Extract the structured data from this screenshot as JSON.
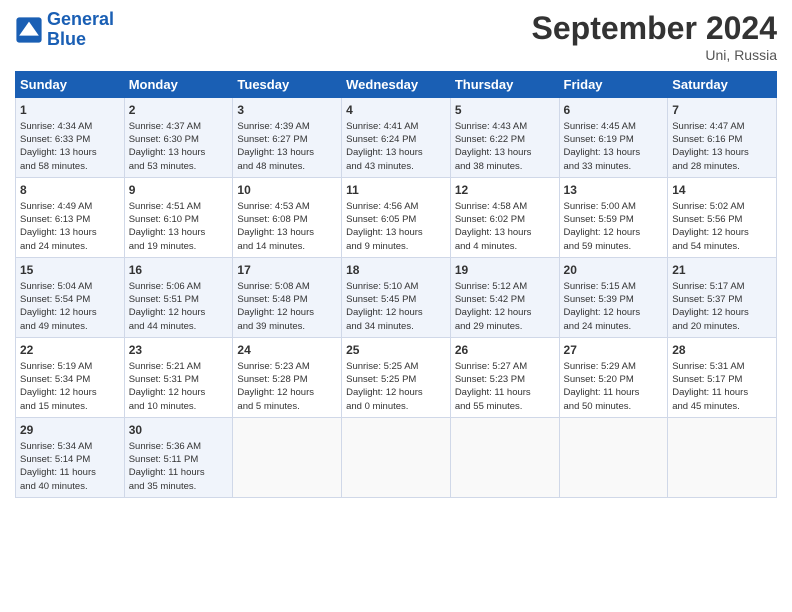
{
  "header": {
    "logo_line1": "General",
    "logo_line2": "Blue",
    "month": "September 2024",
    "location": "Uni, Russia"
  },
  "days_of_week": [
    "Sunday",
    "Monday",
    "Tuesday",
    "Wednesday",
    "Thursday",
    "Friday",
    "Saturday"
  ],
  "weeks": [
    [
      {
        "day": "1",
        "lines": [
          "Sunrise: 4:34 AM",
          "Sunset: 6:33 PM",
          "Daylight: 13 hours",
          "and 58 minutes."
        ]
      },
      {
        "day": "2",
        "lines": [
          "Sunrise: 4:37 AM",
          "Sunset: 6:30 PM",
          "Daylight: 13 hours",
          "and 53 minutes."
        ]
      },
      {
        "day": "3",
        "lines": [
          "Sunrise: 4:39 AM",
          "Sunset: 6:27 PM",
          "Daylight: 13 hours",
          "and 48 minutes."
        ]
      },
      {
        "day": "4",
        "lines": [
          "Sunrise: 4:41 AM",
          "Sunset: 6:24 PM",
          "Daylight: 13 hours",
          "and 43 minutes."
        ]
      },
      {
        "day": "5",
        "lines": [
          "Sunrise: 4:43 AM",
          "Sunset: 6:22 PM",
          "Daylight: 13 hours",
          "and 38 minutes."
        ]
      },
      {
        "day": "6",
        "lines": [
          "Sunrise: 4:45 AM",
          "Sunset: 6:19 PM",
          "Daylight: 13 hours",
          "and 33 minutes."
        ]
      },
      {
        "day": "7",
        "lines": [
          "Sunrise: 4:47 AM",
          "Sunset: 6:16 PM",
          "Daylight: 13 hours",
          "and 28 minutes."
        ]
      }
    ],
    [
      {
        "day": "8",
        "lines": [
          "Sunrise: 4:49 AM",
          "Sunset: 6:13 PM",
          "Daylight: 13 hours",
          "and 24 minutes."
        ]
      },
      {
        "day": "9",
        "lines": [
          "Sunrise: 4:51 AM",
          "Sunset: 6:10 PM",
          "Daylight: 13 hours",
          "and 19 minutes."
        ]
      },
      {
        "day": "10",
        "lines": [
          "Sunrise: 4:53 AM",
          "Sunset: 6:08 PM",
          "Daylight: 13 hours",
          "and 14 minutes."
        ]
      },
      {
        "day": "11",
        "lines": [
          "Sunrise: 4:56 AM",
          "Sunset: 6:05 PM",
          "Daylight: 13 hours",
          "and 9 minutes."
        ]
      },
      {
        "day": "12",
        "lines": [
          "Sunrise: 4:58 AM",
          "Sunset: 6:02 PM",
          "Daylight: 13 hours",
          "and 4 minutes."
        ]
      },
      {
        "day": "13",
        "lines": [
          "Sunrise: 5:00 AM",
          "Sunset: 5:59 PM",
          "Daylight: 12 hours",
          "and 59 minutes."
        ]
      },
      {
        "day": "14",
        "lines": [
          "Sunrise: 5:02 AM",
          "Sunset: 5:56 PM",
          "Daylight: 12 hours",
          "and 54 minutes."
        ]
      }
    ],
    [
      {
        "day": "15",
        "lines": [
          "Sunrise: 5:04 AM",
          "Sunset: 5:54 PM",
          "Daylight: 12 hours",
          "and 49 minutes."
        ]
      },
      {
        "day": "16",
        "lines": [
          "Sunrise: 5:06 AM",
          "Sunset: 5:51 PM",
          "Daylight: 12 hours",
          "and 44 minutes."
        ]
      },
      {
        "day": "17",
        "lines": [
          "Sunrise: 5:08 AM",
          "Sunset: 5:48 PM",
          "Daylight: 12 hours",
          "and 39 minutes."
        ]
      },
      {
        "day": "18",
        "lines": [
          "Sunrise: 5:10 AM",
          "Sunset: 5:45 PM",
          "Daylight: 12 hours",
          "and 34 minutes."
        ]
      },
      {
        "day": "19",
        "lines": [
          "Sunrise: 5:12 AM",
          "Sunset: 5:42 PM",
          "Daylight: 12 hours",
          "and 29 minutes."
        ]
      },
      {
        "day": "20",
        "lines": [
          "Sunrise: 5:15 AM",
          "Sunset: 5:39 PM",
          "Daylight: 12 hours",
          "and 24 minutes."
        ]
      },
      {
        "day": "21",
        "lines": [
          "Sunrise: 5:17 AM",
          "Sunset: 5:37 PM",
          "Daylight: 12 hours",
          "and 20 minutes."
        ]
      }
    ],
    [
      {
        "day": "22",
        "lines": [
          "Sunrise: 5:19 AM",
          "Sunset: 5:34 PM",
          "Daylight: 12 hours",
          "and 15 minutes."
        ]
      },
      {
        "day": "23",
        "lines": [
          "Sunrise: 5:21 AM",
          "Sunset: 5:31 PM",
          "Daylight: 12 hours",
          "and 10 minutes."
        ]
      },
      {
        "day": "24",
        "lines": [
          "Sunrise: 5:23 AM",
          "Sunset: 5:28 PM",
          "Daylight: 12 hours",
          "and 5 minutes."
        ]
      },
      {
        "day": "25",
        "lines": [
          "Sunrise: 5:25 AM",
          "Sunset: 5:25 PM",
          "Daylight: 12 hours",
          "and 0 minutes."
        ]
      },
      {
        "day": "26",
        "lines": [
          "Sunrise: 5:27 AM",
          "Sunset: 5:23 PM",
          "Daylight: 11 hours",
          "and 55 minutes."
        ]
      },
      {
        "day": "27",
        "lines": [
          "Sunrise: 5:29 AM",
          "Sunset: 5:20 PM",
          "Daylight: 11 hours",
          "and 50 minutes."
        ]
      },
      {
        "day": "28",
        "lines": [
          "Sunrise: 5:31 AM",
          "Sunset: 5:17 PM",
          "Daylight: 11 hours",
          "and 45 minutes."
        ]
      }
    ],
    [
      {
        "day": "29",
        "lines": [
          "Sunrise: 5:34 AM",
          "Sunset: 5:14 PM",
          "Daylight: 11 hours",
          "and 40 minutes."
        ]
      },
      {
        "day": "30",
        "lines": [
          "Sunrise: 5:36 AM",
          "Sunset: 5:11 PM",
          "Daylight: 11 hours",
          "and 35 minutes."
        ]
      },
      null,
      null,
      null,
      null,
      null
    ]
  ]
}
